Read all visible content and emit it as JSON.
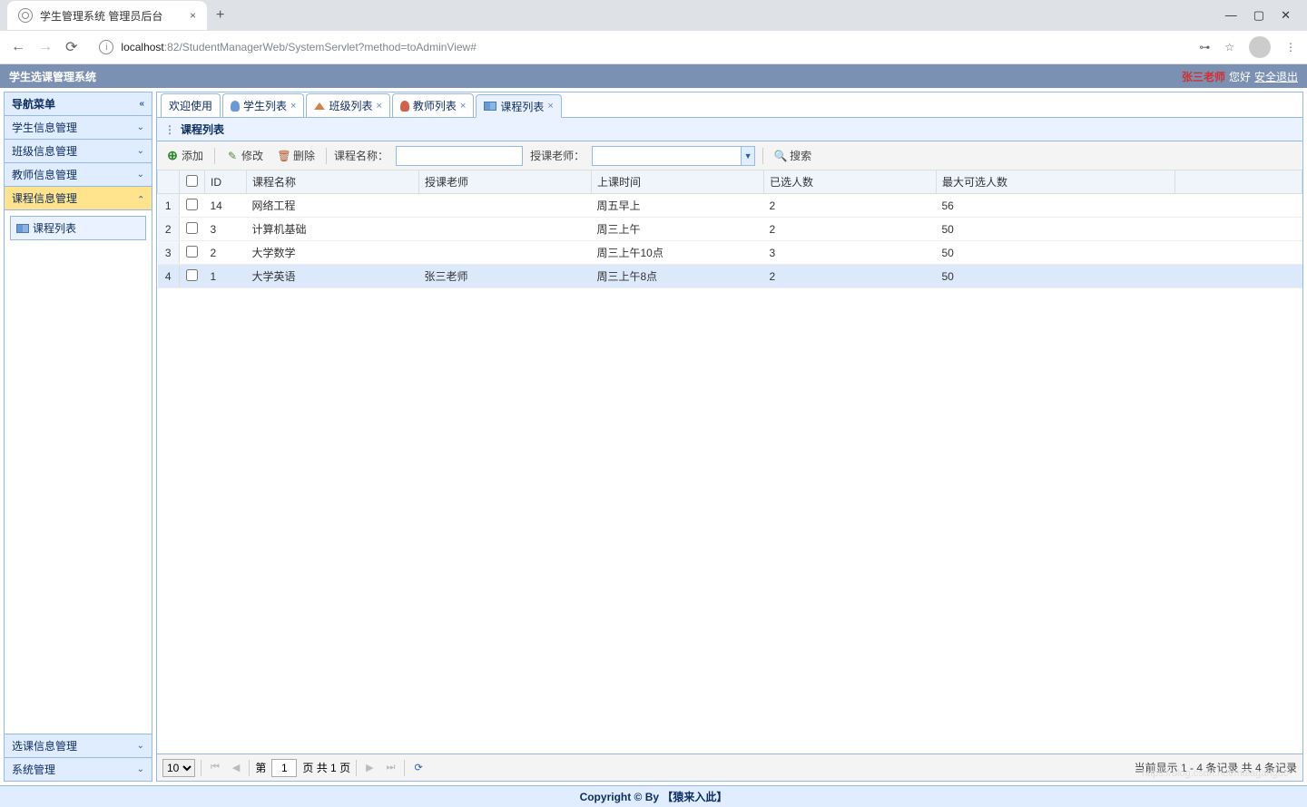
{
  "browser": {
    "tab_title": "学生管理系统 管理员后台",
    "url_host": "localhost",
    "url_port": ":82",
    "url_path": "/StudentManagerWeb/SystemServlet?method=toAdminView#"
  },
  "header": {
    "title": "学生选课管理系统",
    "username": "张三老师",
    "greeting": "您好",
    "logout": "安全退出"
  },
  "sidebar": {
    "title": "导航菜单",
    "items": [
      {
        "label": "学生信息管理",
        "selected": false
      },
      {
        "label": "班级信息管理",
        "selected": false
      },
      {
        "label": "教师信息管理",
        "selected": false
      },
      {
        "label": "课程信息管理",
        "selected": true
      }
    ],
    "sub_link": "课程列表",
    "bottom_items": [
      {
        "label": "选课信息管理"
      },
      {
        "label": "系统管理"
      }
    ]
  },
  "tabs": [
    {
      "label": "欢迎使用",
      "closable": false,
      "icon": null
    },
    {
      "label": "学生列表",
      "closable": true,
      "icon": "user"
    },
    {
      "label": "班级列表",
      "closable": true,
      "icon": "home"
    },
    {
      "label": "教师列表",
      "closable": true,
      "icon": "teacher"
    },
    {
      "label": "课程列表",
      "closable": true,
      "icon": "book",
      "active": true
    }
  ],
  "panel": {
    "title": "课程列表"
  },
  "toolbar": {
    "add": "添加",
    "edit": "修改",
    "delete": "删除",
    "name_label": "课程名称：",
    "teacher_label": "授课老师：",
    "search": "搜索"
  },
  "grid": {
    "columns": [
      "ID",
      "课程名称",
      "授课老师",
      "上课时间",
      "已选人数",
      "最大可选人数"
    ],
    "rows": [
      {
        "num": "1",
        "id": "14",
        "name": "网络工程",
        "teacher": "",
        "time": "周五早上",
        "selected": "2",
        "max": "56"
      },
      {
        "num": "2",
        "id": "3",
        "name": "计算机基础",
        "teacher": "",
        "time": "周三上午",
        "selected": "2",
        "max": "50"
      },
      {
        "num": "3",
        "id": "2",
        "name": "大学数学",
        "teacher": "",
        "time": "周三上午10点",
        "selected": "3",
        "max": "50"
      },
      {
        "num": "4",
        "id": "1",
        "name": "大学英语",
        "teacher": "张三老师",
        "time": "周三上午8点",
        "selected": "2",
        "max": "50"
      }
    ]
  },
  "pagination": {
    "page_size": "10",
    "before_page": "第",
    "current_page": "1",
    "after_page": "页 共 1 页",
    "info": "当前显示 1 - 4 条记录 共 4 条记录"
  },
  "footer": {
    "text": "Copyright © By 【猿来入此】"
  }
}
